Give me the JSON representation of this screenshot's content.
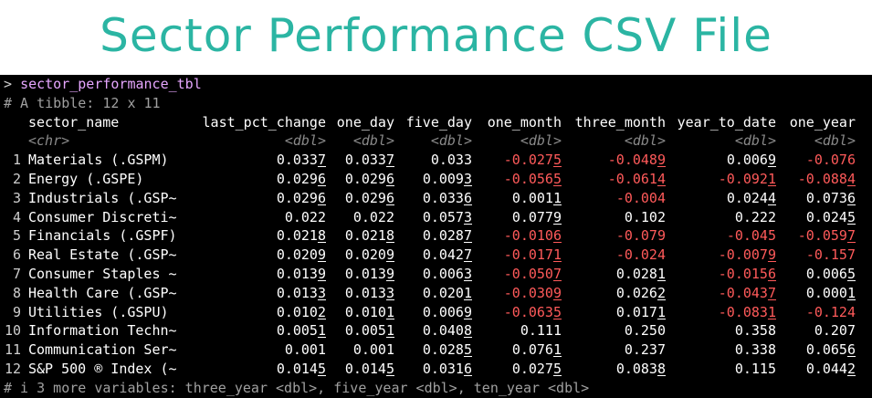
{
  "banner": {
    "title": "Sector Performance CSV File"
  },
  "console": {
    "prompt_symbol": ">",
    "command": "sector_performance_tbl",
    "tibble_info": "# A tibble: 12 x 11",
    "footer": "# i 3 more variables: three_year <dbl>, five_year <dbl>, ten_year <dbl>",
    "colors": {
      "negative": "#ff5a5a",
      "command": "#e6a6ff",
      "comment": "#a0a0a0"
    }
  },
  "table": {
    "columns": [
      "sector_name",
      "last_pct_change",
      "one_day",
      "five_day",
      "one_month",
      "three_month",
      "year_to_date",
      "one_year"
    ],
    "types": [
      "<chr>",
      "<dbl>",
      "<dbl>",
      "<dbl>",
      "<dbl>",
      "<dbl>",
      "<dbl>",
      "<dbl>"
    ],
    "rows": [
      {
        "n": "1",
        "sector": "Materials (.GSPM)",
        "v": [
          [
            "0.033",
            "7"
          ],
          [
            "0.033",
            "7"
          ],
          [
            "0.033",
            ""
          ],
          [
            "-0.027",
            "5"
          ],
          [
            "-0.048",
            "9"
          ],
          [
            "0.006",
            "9"
          ],
          [
            "-0.076",
            ""
          ]
        ]
      },
      {
        "n": "2",
        "sector": "Energy (.GSPE)",
        "v": [
          [
            "0.029",
            "6"
          ],
          [
            "0.029",
            "6"
          ],
          [
            "0.009",
            "3"
          ],
          [
            "-0.056",
            "5"
          ],
          [
            "-0.061",
            "4"
          ],
          [
            "-0.092",
            "1"
          ],
          [
            "-0.088",
            "4"
          ]
        ]
      },
      {
        "n": "3",
        "sector": "Industrials (.GSP~",
        "v": [
          [
            "0.029",
            "6"
          ],
          [
            "0.029",
            "6"
          ],
          [
            "0.033",
            "6"
          ],
          [
            "0.001",
            "1"
          ],
          [
            "-0.004",
            ""
          ],
          [
            "0.024",
            "4"
          ],
          [
            "0.073",
            "6"
          ]
        ]
      },
      {
        "n": "4",
        "sector": "Consumer Discreti~",
        "v": [
          [
            "0.022",
            ""
          ],
          [
            "0.022",
            ""
          ],
          [
            "0.057",
            "3"
          ],
          [
            "0.077",
            "9"
          ],
          [
            "0.102",
            ""
          ],
          [
            "0.222",
            ""
          ],
          [
            "0.024",
            "5"
          ]
        ]
      },
      {
        "n": "5",
        "sector": "Financials (.GSPF)",
        "v": [
          [
            "0.021",
            "8"
          ],
          [
            "0.021",
            "8"
          ],
          [
            "0.028",
            "7"
          ],
          [
            "-0.010",
            "6"
          ],
          [
            "-0.079",
            ""
          ],
          [
            "-0.045",
            ""
          ],
          [
            "-0.059",
            "7"
          ]
        ]
      },
      {
        "n": "6",
        "sector": "Real Estate (.GSP~",
        "v": [
          [
            "0.020",
            "9"
          ],
          [
            "0.020",
            "9"
          ],
          [
            "0.042",
            "7"
          ],
          [
            "-0.017",
            "1"
          ],
          [
            "-0.024",
            ""
          ],
          [
            "-0.007",
            "9"
          ],
          [
            "-0.157",
            ""
          ]
        ]
      },
      {
        "n": "7",
        "sector": "Consumer Staples ~",
        "v": [
          [
            "0.013",
            "9"
          ],
          [
            "0.013",
            "9"
          ],
          [
            "0.006",
            "3"
          ],
          [
            "-0.050",
            "7"
          ],
          [
            "0.028",
            "1"
          ],
          [
            "-0.015",
            "6"
          ],
          [
            "0.006",
            "5"
          ]
        ]
      },
      {
        "n": "8",
        "sector": "Health Care (.GSP~",
        "v": [
          [
            "0.013",
            "3"
          ],
          [
            "0.013",
            "3"
          ],
          [
            "0.020",
            "1"
          ],
          [
            "-0.030",
            "9"
          ],
          [
            "0.026",
            "2"
          ],
          [
            "-0.043",
            "7"
          ],
          [
            "0.000",
            "1"
          ]
        ]
      },
      {
        "n": "9",
        "sector": "Utilities (.GSPU)",
        "v": [
          [
            "0.010",
            "2"
          ],
          [
            "0.010",
            "1"
          ],
          [
            "0.006",
            "9"
          ],
          [
            "-0.063",
            "5"
          ],
          [
            "0.017",
            "1"
          ],
          [
            "-0.083",
            "1"
          ],
          [
            "-0.124",
            ""
          ]
        ]
      },
      {
        "n": "10",
        "sector": "Information Techn~",
        "v": [
          [
            "0.005",
            "1"
          ],
          [
            "0.005",
            "1"
          ],
          [
            "0.040",
            "8"
          ],
          [
            "0.111",
            ""
          ],
          [
            "0.250",
            ""
          ],
          [
            "0.358",
            ""
          ],
          [
            "0.207",
            ""
          ]
        ]
      },
      {
        "n": "11",
        "sector": "Communication Ser~",
        "v": [
          [
            "0.001",
            ""
          ],
          [
            "0.001",
            ""
          ],
          [
            "0.028",
            "5"
          ],
          [
            "0.076",
            "1"
          ],
          [
            "0.237",
            ""
          ],
          [
            "0.338",
            ""
          ],
          [
            "0.065",
            "6"
          ]
        ]
      },
      {
        "n": "12",
        "sector": "S&P 500 ® Index (~",
        "v": [
          [
            "0.014",
            "5"
          ],
          [
            "0.014",
            "5"
          ],
          [
            "0.031",
            "6"
          ],
          [
            "0.027",
            "5"
          ],
          [
            "0.083",
            "8"
          ],
          [
            "0.115",
            ""
          ],
          [
            "0.044",
            "2"
          ]
        ]
      }
    ]
  }
}
